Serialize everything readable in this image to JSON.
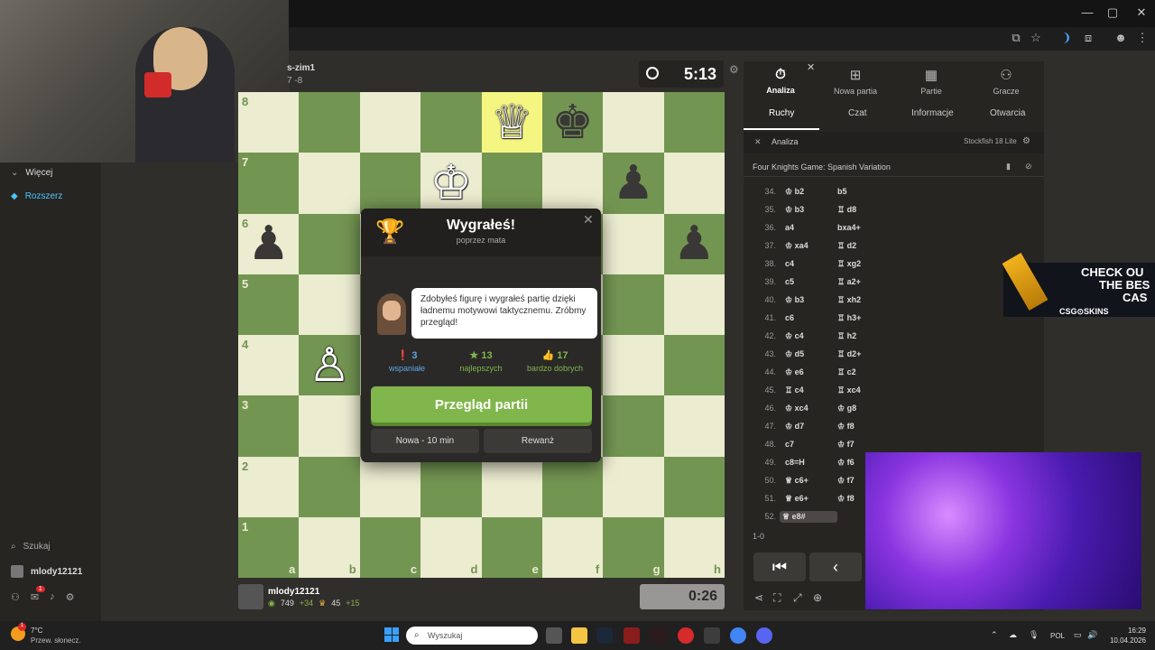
{
  "sidebar": {
    "more_label": "Więcej",
    "extend_label": "Rozszerz",
    "search_label": "Szukaj",
    "username": "mlody12121",
    "mail_badge": "1"
  },
  "opponent": {
    "name": "s-zim1",
    "rating_line": "7 -8",
    "clock": "5:13"
  },
  "me": {
    "name": "mlody12121",
    "rating": "749",
    "rating_delta": "+34",
    "trophy": "45",
    "trophy_delta": "+15",
    "clock": "0:26"
  },
  "board": {
    "ranks": [
      "8",
      "7",
      "6",
      "5",
      "4",
      "3",
      "2",
      "1"
    ],
    "files": [
      "a",
      "b",
      "c",
      "d",
      "e",
      "f",
      "g",
      "h"
    ],
    "pieces": [
      {
        "sq": "e8",
        "glyph": "♕",
        "side": "w"
      },
      {
        "sq": "f8",
        "glyph": "♚",
        "side": "b"
      },
      {
        "sq": "d7",
        "glyph": "♔",
        "side": "w"
      },
      {
        "sq": "g7",
        "glyph": "♟",
        "side": "b"
      },
      {
        "sq": "a6",
        "glyph": "♟",
        "side": "b"
      },
      {
        "sq": "h6",
        "glyph": "♟",
        "side": "b"
      },
      {
        "sq": "b4",
        "glyph": "♙",
        "side": "w"
      }
    ],
    "highlight": "e8"
  },
  "modal": {
    "title": "Wygrałeś!",
    "subtitle": "poprzez mata",
    "coach_text": "Zdobyłeś figurę i wygrałeś partię dzięki ładnemu motywowi taktycznemu. Zróbmy przegląd!",
    "stats": [
      {
        "num": "3",
        "label": "wspaniałe",
        "color": "#5fa6e6"
      },
      {
        "num": "13",
        "label": "najlepszych",
        "color": "#81b64c"
      },
      {
        "num": "17",
        "label": "bardzo dobrych",
        "color": "#81b64c"
      }
    ],
    "review_button": "Przegląd partii",
    "new_game_button": "Nowa - 10 min",
    "rematch_button": "Rewanż"
  },
  "panel": {
    "tabs": [
      "Analiza",
      "Nowa partia",
      "Partie",
      "Gracze"
    ],
    "subtabs": [
      "Ruchy",
      "Czat",
      "Informacje",
      "Otwarcia"
    ],
    "analysis_label": "Analiza",
    "engine": "Stockfish 18 Lite",
    "opening": "Four Knights Game: Spanish Variation",
    "moves": [
      {
        "n": "34.",
        "w": "♔ b2",
        "b": "b5"
      },
      {
        "n": "35.",
        "w": "♔ b3",
        "b": "♖ d8"
      },
      {
        "n": "36.",
        "w": "a4",
        "b": "bxa4+"
      },
      {
        "n": "37.",
        "w": "♔ xa4",
        "b": "♖ d2"
      },
      {
        "n": "38.",
        "w": "c4",
        "b": "♖ xg2"
      },
      {
        "n": "39.",
        "w": "c5",
        "b": "♖ a2+"
      },
      {
        "n": "40.",
        "w": "♔ b3",
        "b": "♖ xh2"
      },
      {
        "n": "41.",
        "w": "c6",
        "b": "♖ h3+"
      },
      {
        "n": "42.",
        "w": "♔ c4",
        "b": "♖ h2"
      },
      {
        "n": "43.",
        "w": "♔ d5",
        "b": "♖ d2+"
      },
      {
        "n": "44.",
        "w": "♔ e6",
        "b": "♖ c2"
      },
      {
        "n": "45.",
        "w": "♖ c4",
        "b": "♖ xc4"
      },
      {
        "n": "46.",
        "w": "♔ xc4",
        "b": "♔ g8"
      },
      {
        "n": "47.",
        "w": "♔ d7",
        "b": "♔ f8"
      },
      {
        "n": "48.",
        "w": "c7",
        "b": "♔ f7"
      },
      {
        "n": "49.",
        "w": "c8=H",
        "b": "♔ f6"
      },
      {
        "n": "50.",
        "w": "♕ c6+",
        "b": "♔ f7"
      },
      {
        "n": "51.",
        "w": "♕ e6+",
        "b": "♔ f8"
      },
      {
        "n": "52.",
        "w": "♕ e8#",
        "b": ""
      }
    ],
    "result": "1-0"
  },
  "ad": {
    "line1": "CHECK OU",
    "line2": "THE BES",
    "line3": "CAS",
    "brand": "CSG⊙SKINS"
  },
  "taskbar": {
    "temperature": "7°C",
    "weather": "Przew. słonecz.",
    "search_placeholder": "Wyszukaj",
    "lang": "POL",
    "time": "16:29",
    "date": "10.04.2026"
  }
}
